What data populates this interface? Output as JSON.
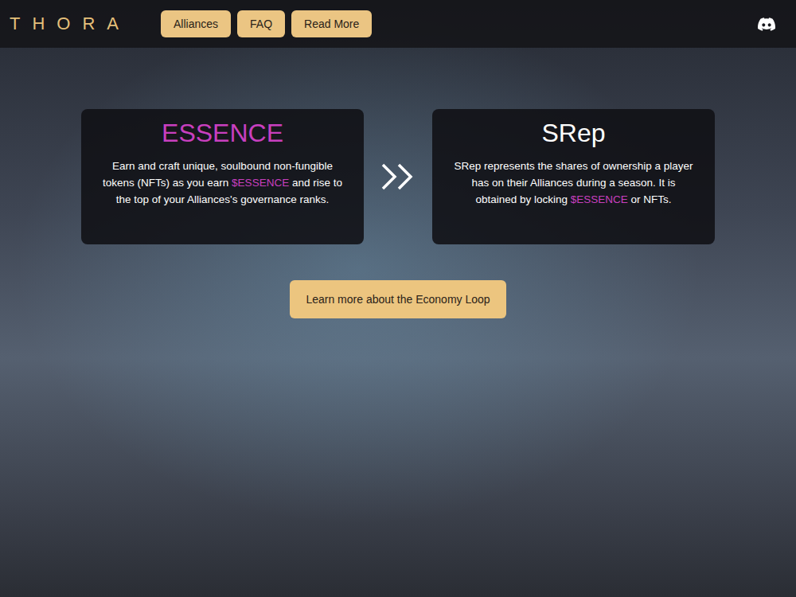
{
  "logo": "THORA",
  "nav": [
    {
      "label": "Alliances"
    },
    {
      "label": "FAQ"
    },
    {
      "label": "Read More"
    }
  ],
  "cards": [
    {
      "title": "ESSENCE",
      "color": "#c83fbf",
      "body": [
        {
          "text": "Earn and craft unique, soulbound non-fungible tokens (NFTs) as you earn ",
          "highlight": false
        },
        {
          "text": "$ESSENCE",
          "highlight": true
        },
        {
          "text": " and rise to the top of your Alliances's governance ranks.",
          "highlight": false
        }
      ]
    },
    {
      "title": "SRep",
      "color": "#ffffff",
      "body": [
        {
          "text": "SRep represents the shares of ownership a player has on their Alliances during a season. It is obtained by locking ",
          "highlight": false
        },
        {
          "text": "$ESSENCE",
          "highlight": true
        },
        {
          "text": " or NFTs.",
          "highlight": false
        }
      ]
    }
  ],
  "cta": "Learn more about the Economy Loop"
}
